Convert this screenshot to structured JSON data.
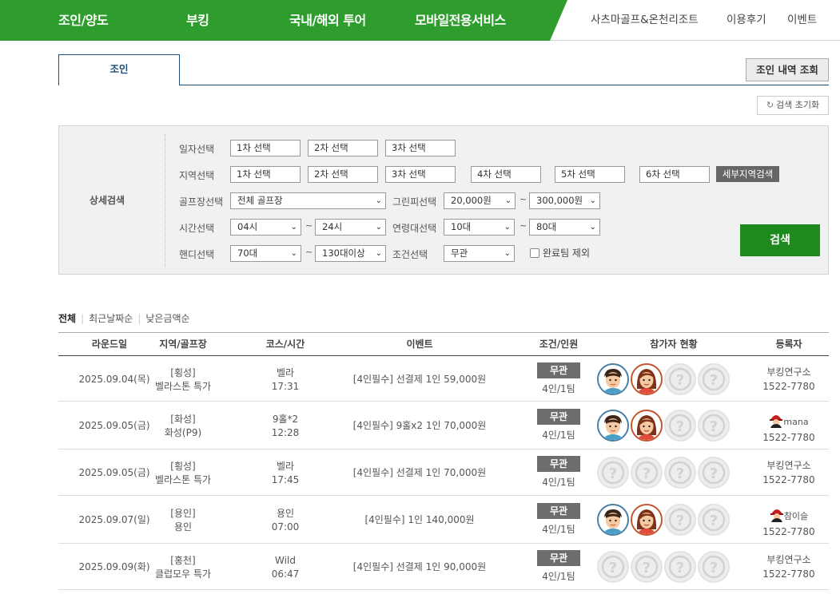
{
  "nav": {
    "main": [
      "조인/양도",
      "부킹",
      "국내/해외 투어",
      "모바일전용서비스"
    ],
    "right": [
      "사츠마골프&온천리조트",
      "이용후기",
      "이벤트"
    ]
  },
  "tabs": {
    "join": "조인",
    "history_button": "조인 내역 조회"
  },
  "reset_button": "검색 초기화",
  "search": {
    "title": "상세검색",
    "date_label": "일자선택",
    "date_boxes": [
      "1차 선택",
      "2차 선택",
      "3차 선택"
    ],
    "region_label": "지역선택",
    "region_boxes": [
      "1차 선택",
      "2차 선택",
      "3차 선택",
      "4차 선택",
      "5차 선택",
      "6차 선택"
    ],
    "detail_region_button": "세부지역검색",
    "course_label": "골프장선택",
    "course_value": "전체 골프장",
    "greenfee_label": "그린피선택",
    "greenfee_from": "20,000원",
    "greenfee_to": "300,000원",
    "time_label": "시간선택",
    "time_from": "04시",
    "time_to": "24시",
    "age_label": "연령대선택",
    "age_from": "10대",
    "age_to": "80대",
    "handicap_label": "핸디선택",
    "handicap_from": "70대",
    "handicap_to": "130대이상",
    "condition_label": "조건선택",
    "condition_value": "무관",
    "exclude_label": "완료팀 제외",
    "tilde": "~",
    "search_button": "검색"
  },
  "sort": {
    "all": "전체",
    "recent": "최근날짜순",
    "low_price": "낮은금액순"
  },
  "table": {
    "headers": [
      "라운드일",
      "지역/골프장",
      "코스/시간",
      "이벤트",
      "조건/인원",
      "참가자 현황",
      "등록자"
    ],
    "rows": [
      {
        "date": "2025.09.04(목)",
        "region": "[횡성]",
        "course": "벨라스톤 특가",
        "course_name": "벨라",
        "time": "17:31",
        "event": "[4인필수] 선결제 1인 59,000원",
        "cond": "무관",
        "people": "4인/1팀",
        "avatars": [
          "m",
          "f",
          "e",
          "e"
        ],
        "registrant_name": "부킹연구소",
        "registrant_phone": "1522-7780",
        "user_icon": false
      },
      {
        "date": "2025.09.05(금)",
        "region": "[화성]",
        "course": "화성(P9)",
        "course_name": "9홀*2",
        "time": "12:28",
        "event": "[4인필수] 9홀x2 1인 70,000원",
        "cond": "무관",
        "people": "4인/1팀",
        "avatars": [
          "m",
          "f",
          "e",
          "e"
        ],
        "registrant_name": "mana",
        "registrant_phone": "1522-7780",
        "user_icon": true
      },
      {
        "date": "2025.09.05(금)",
        "region": "[횡성]",
        "course": "벨라스톤 특가",
        "course_name": "벨라",
        "time": "17:45",
        "event": "[4인필수] 선결제 1인 70,000원",
        "cond": "무관",
        "people": "4인/1팀",
        "avatars": [
          "e",
          "e",
          "e",
          "e"
        ],
        "registrant_name": "부킹연구소",
        "registrant_phone": "1522-7780",
        "user_icon": false
      },
      {
        "date": "2025.09.07(일)",
        "region": "[용인]",
        "course": "용인",
        "course_name": "용인",
        "time": "07:00",
        "event": "[4인필수] 1인 140,000원",
        "cond": "무관",
        "people": "4인/1팀",
        "avatars": [
          "m",
          "f",
          "e",
          "e"
        ],
        "registrant_name": "참이슬",
        "registrant_phone": "1522-7780",
        "user_icon": true
      },
      {
        "date": "2025.09.09(화)",
        "region": "[홍천]",
        "course": "클럽모우 특가",
        "course_name": "Wild",
        "time": "06:47",
        "event": "[4인필수] 선결제 1인 90,000원",
        "cond": "무관",
        "people": "4인/1팀",
        "avatars": [
          "e",
          "e",
          "e",
          "e"
        ],
        "registrant_name": "부킹연구소",
        "registrant_phone": "1522-7780",
        "user_icon": false
      }
    ]
  },
  "colors": {
    "brand_green": "#2e9d2e",
    "search_green": "#1e8a1e",
    "tab_blue": "#1f4e79",
    "badge_gray": "#6d6d6d"
  }
}
